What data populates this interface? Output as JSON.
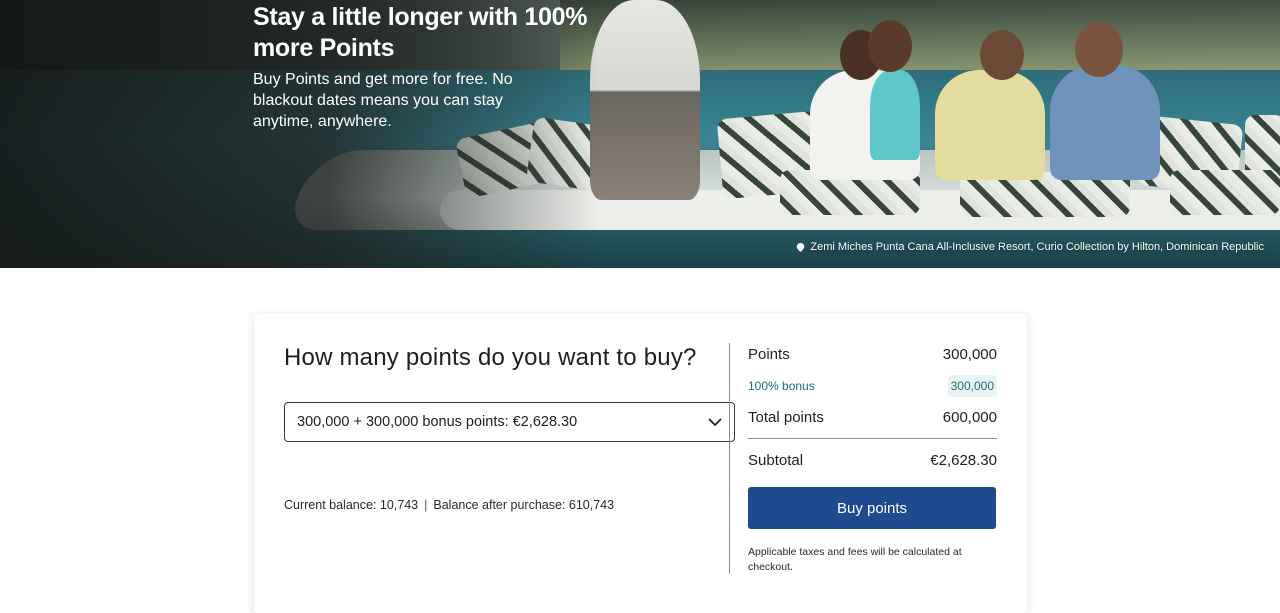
{
  "hero": {
    "title": "Stay a little longer with 100% more Points",
    "subtitle": "Buy Points and get more for free. No blackout dates means you can stay anytime, anywhere.",
    "caption": "Zemi Miches Punta Cana All-Inclusive Resort, Curio Collection by Hilton, Dominican Republic",
    "caption_icon": "map-pin-icon"
  },
  "purchase": {
    "heading": "How many points do you want to buy?",
    "selected_option": "300,000 + 300,000 bonus points: €2,628.30",
    "dropdown_icon": "chevron-down-icon",
    "current_balance": "Current balance: 10,743",
    "separator": "|",
    "balance_after": "Balance after purchase: 610,743"
  },
  "summary": {
    "points_label": "Points",
    "points_value": "300,000",
    "bonus_label": "100% bonus",
    "bonus_value": "300,000",
    "total_label": "Total points",
    "total_value": "600,000",
    "subtotal_label": "Subtotal",
    "subtotal_value": "€2,628.30",
    "buy_button": "Buy points",
    "note": "Applicable taxes and fees will be calculated at checkout."
  },
  "colors": {
    "primary_button": "#1e4a8f",
    "bonus_text": "#1f6f72",
    "bonus_badge_bg": "#e6f4f3"
  }
}
